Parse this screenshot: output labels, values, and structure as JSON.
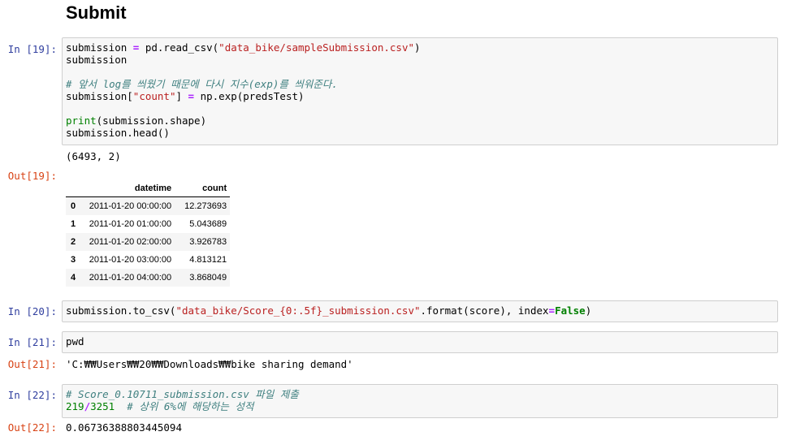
{
  "heading": "Submit",
  "cells": {
    "c19": {
      "in_prompt": "In [19]:",
      "out_prompt": "Out[19]:",
      "line1": [
        "submission ",
        "=",
        " pd.read_csv(",
        "\"data_bike/sampleSubmission.csv\"",
        ")"
      ],
      "line2": "submission",
      "comment": "# 앞서 log를 씌웠기 때문에 다시 지수(exp)를 씌워준다.",
      "line4": [
        "submission[",
        "\"count\"",
        "] ",
        "=",
        " np.exp(predsTest)"
      ],
      "line5": [
        "print",
        "(submission.shape)"
      ],
      "line6": "submission.head()",
      "stdout": "(6493, 2)",
      "table": {
        "columns": [
          "",
          "datetime",
          "count"
        ],
        "rows": [
          {
            "idx": "0",
            "datetime": "2011-01-20 00:00:00",
            "count": "12.273693"
          },
          {
            "idx": "1",
            "datetime": "2011-01-20 01:00:00",
            "count": "5.043689"
          },
          {
            "idx": "2",
            "datetime": "2011-01-20 02:00:00",
            "count": "3.926783"
          },
          {
            "idx": "3",
            "datetime": "2011-01-20 03:00:00",
            "count": "4.813121"
          },
          {
            "idx": "4",
            "datetime": "2011-01-20 04:00:00",
            "count": "3.868049"
          }
        ]
      }
    },
    "c20": {
      "in_prompt": "In [20]:",
      "code": [
        "submission.to_csv(",
        "\"data_bike/Score_{0:.5f}_submission.csv\"",
        ".format(score), index",
        "=",
        "False",
        ")"
      ]
    },
    "c21": {
      "in_prompt": "In [21]:",
      "out_prompt": "Out[21]:",
      "code": "pwd",
      "output": "'C:₩₩Users₩₩20₩₩Downloads₩₩bike sharing demand'"
    },
    "c22": {
      "in_prompt": "In [22]:",
      "out_prompt": "Out[22]:",
      "comment": "# Score_0.10711_submission.csv 파일 제출",
      "num1": "219",
      "op": "/",
      "num2": "3251",
      "comment2": "  # 상위 6%에 해당하는 성적",
      "output": "0.06736388803445094"
    }
  }
}
